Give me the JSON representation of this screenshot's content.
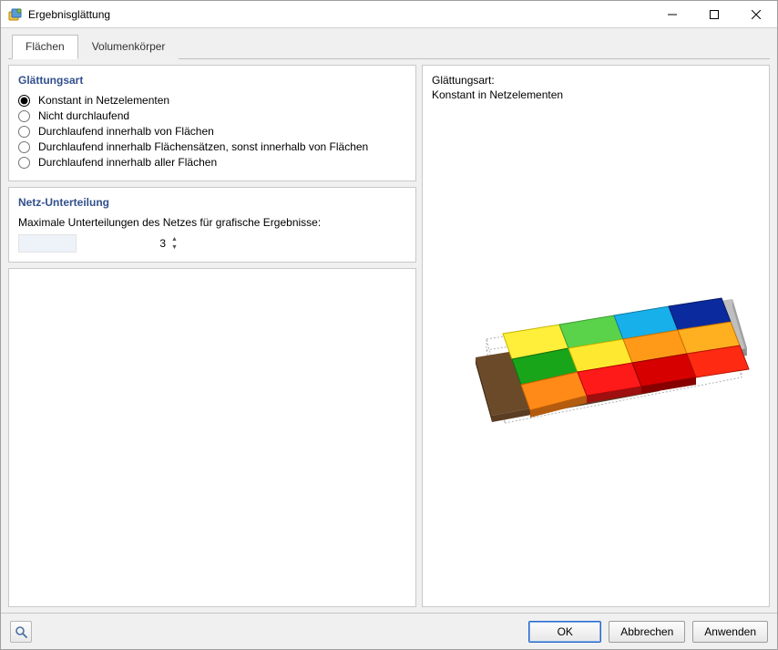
{
  "window": {
    "title": "Ergebnisglättung"
  },
  "tabs": {
    "surfaces": "Flächen",
    "solids": "Volumenkörper"
  },
  "smoothing": {
    "section_title": "Glättungsart",
    "options": {
      "const_elems": "Konstant in Netzelementen",
      "non_cont": "Nicht durchlaufend",
      "cont_surfaces": "Durchlaufend innerhalb von Flächen",
      "cont_surfacesets": "Durchlaufend innerhalb Flächensätzen, sonst innerhalb von Flächen",
      "cont_all": "Durchlaufend innerhalb aller Flächen"
    },
    "selected": "const_elems"
  },
  "subdivision": {
    "section_title": "Netz-Unterteilung",
    "label": "Maximale Unterteilungen des Netzes für grafische Ergebnisse:",
    "value": "3"
  },
  "preview": {
    "label_line1": "Glättungsart:",
    "label_line2": "Konstant in Netzelementen"
  },
  "footer": {
    "ok": "OK",
    "cancel": "Abbrechen",
    "apply": "Anwenden"
  }
}
